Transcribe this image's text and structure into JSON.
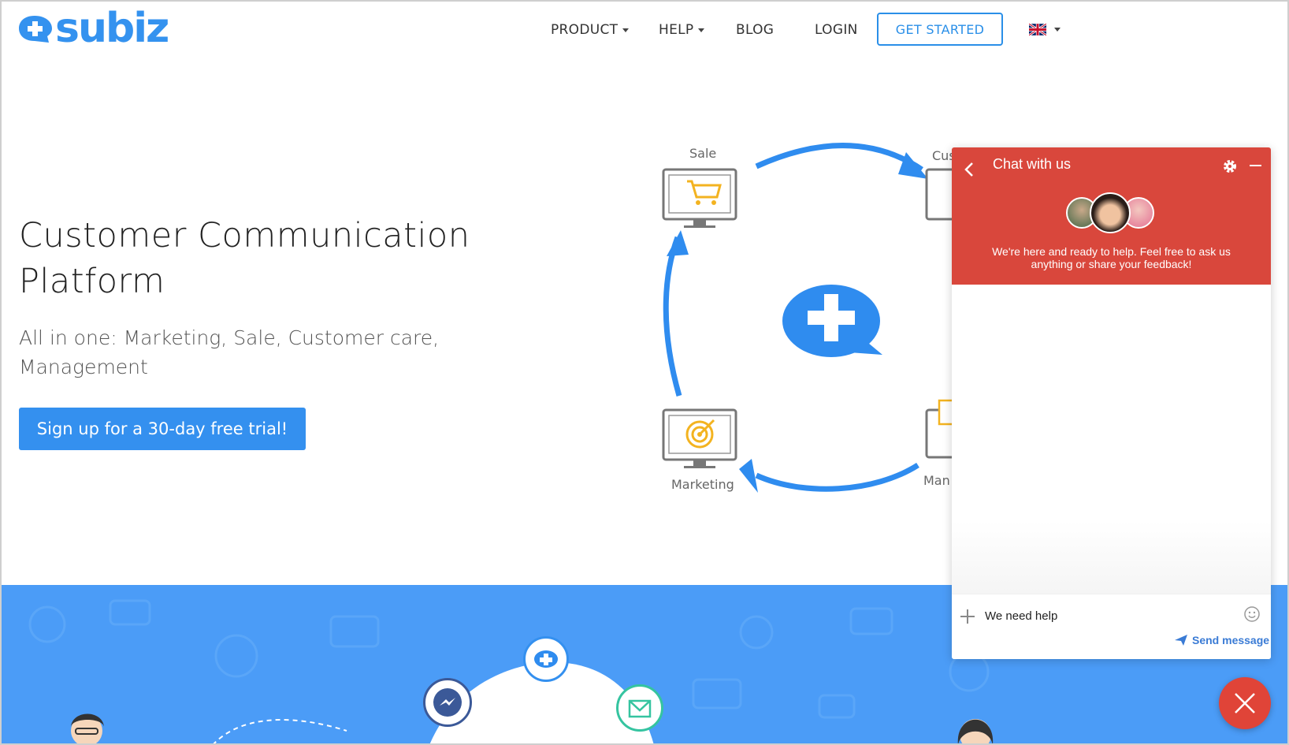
{
  "brand": {
    "name": "subiz",
    "color": "#3492ef"
  },
  "nav": {
    "product": "PRODUCT",
    "help": "HELP",
    "blog": "BLOG",
    "login": "LOGIN",
    "get_started": "GET STARTED",
    "language_icon": "uk-flag-icon"
  },
  "hero": {
    "title_line1": "Customer Communication",
    "title_line2": "Platform",
    "subtitle_line1": "All in one: Marketing, Sale, Customer care,",
    "subtitle_line2": "Management",
    "cta": "Sign up for a 30-day free trial!",
    "accent": "#3490ef"
  },
  "diagram": {
    "sale": "Sale",
    "customer_care": "Cus",
    "marketing": "Marketing",
    "management": "Man"
  },
  "chat": {
    "title": "Chat with us",
    "description_line1": "We're here and ready to help. Feel free to ask us",
    "description_line2": "anything or share your feedback!",
    "input_value": "We need help",
    "send_label": "Send message",
    "header_color": "#d9473c"
  }
}
